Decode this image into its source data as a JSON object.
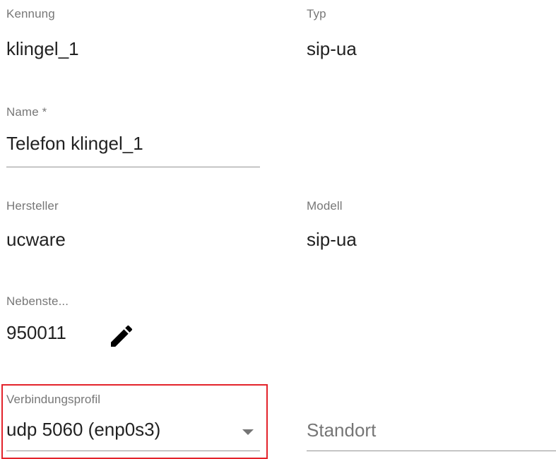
{
  "fields": {
    "kennung": {
      "label": "Kennung",
      "value": "klingel_1"
    },
    "typ": {
      "label": "Typ",
      "value": "sip-ua"
    },
    "name": {
      "label": "Name *",
      "value": "Telefon klingel_1"
    },
    "hersteller": {
      "label": "Hersteller",
      "value": "ucware"
    },
    "modell": {
      "label": "Modell",
      "value": "sip-ua"
    },
    "nebenstelle": {
      "label": "Nebenste...",
      "value": "950011"
    },
    "verbindungsprofil": {
      "label": "Verbindungsprofil",
      "value": "udp 5060 (enp0s3)"
    },
    "standort": {
      "placeholder": "Standort"
    }
  },
  "icons": {
    "edit": "pencil-icon",
    "dropdown": "arrow-drop-down-icon"
  },
  "colors": {
    "highlight": "#e3232b"
  }
}
